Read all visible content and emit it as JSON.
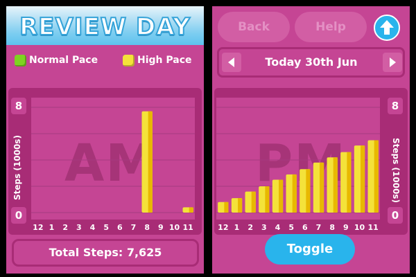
{
  "left_screen": {
    "title": "REVIEW DAY",
    "legend": [
      {
        "label": "Normal Pace",
        "color": "#7ed321"
      },
      {
        "label": "High Pace",
        "color": "#f4e23a"
      }
    ],
    "watermark": "AM",
    "total_steps": "Total Steps: 7,625"
  },
  "right_screen": {
    "back_label": "Back",
    "help_label": "Help",
    "up_icon": "up-arrow-icon",
    "date_label": "Today 30th Jun",
    "watermark": "PM",
    "toggle_label": "Toggle"
  },
  "chart_data": [
    {
      "type": "bar",
      "ylabel": "Steps (1000s)",
      "ylim": [
        0,
        8
      ],
      "yticks": [
        "8",
        "0"
      ],
      "categories": [
        "12",
        "1",
        "2",
        "3",
        "4",
        "5",
        "6",
        "7",
        "8",
        "9",
        "10",
        "11"
      ],
      "values": [
        0,
        0,
        0,
        0,
        0,
        0,
        0,
        0,
        7.7,
        0,
        0,
        0.4
      ],
      "bar_color": "#f4e23a"
    },
    {
      "type": "bar",
      "ylabel": "Steps (1000s)",
      "ylim": [
        0,
        8
      ],
      "yticks": [
        "8",
        "0"
      ],
      "categories": [
        "12",
        "1",
        "2",
        "3",
        "4",
        "5",
        "6",
        "7",
        "8",
        "9",
        "10",
        "11"
      ],
      "values": [
        0.8,
        1.1,
        1.6,
        2.0,
        2.5,
        2.9,
        3.3,
        3.8,
        4.2,
        4.6,
        5.1,
        5.5
      ],
      "bar_color": "#f4e23a"
    }
  ]
}
